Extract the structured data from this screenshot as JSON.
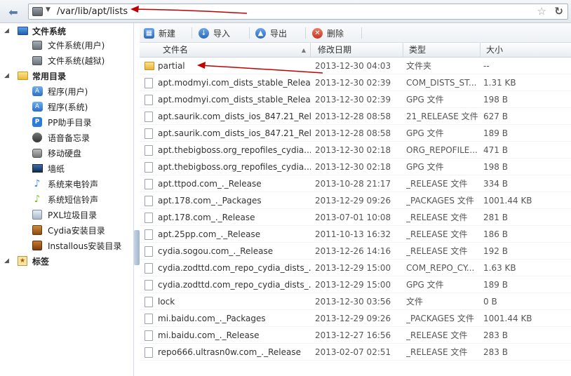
{
  "address": {
    "path": "/var/lib/apt/lists"
  },
  "sidebar": {
    "groups": [
      {
        "label": "文件系统",
        "items": [
          "文件系统(用户)",
          "文件系统(越狱)"
        ]
      },
      {
        "label": "常用目录",
        "items": [
          "程序(用户)",
          "程序(系统)",
          "PP助手目录",
          "语音备忘录",
          "移动硬盘",
          "墙纸",
          "系统来电铃声",
          "系统短信铃声",
          "PXL垃圾目录",
          "Cydia安装目录",
          "Installous安装目录"
        ]
      },
      {
        "label": "标签",
        "items": []
      }
    ]
  },
  "toolbar": {
    "new_label": "新建",
    "import_label": "导入",
    "export_label": "导出",
    "delete_label": "删除"
  },
  "table": {
    "columns": [
      "文件名",
      "修改日期",
      "类型",
      "大小"
    ],
    "rows": [
      {
        "name": "partial",
        "date": "2013-12-30 04:03",
        "type": "文件夹",
        "size": "--",
        "folder": true
      },
      {
        "name": "apt.modmyi.com_dists_stable_Relea...",
        "date": "2013-12-30 02:39",
        "type": "COM_DISTS_ST...",
        "size": "1.31 KB"
      },
      {
        "name": "apt.modmyi.com_dists_stable_Relea...",
        "date": "2013-12-30 02:39",
        "type": "GPG 文件",
        "size": "198 B"
      },
      {
        "name": "apt.saurik.com_dists_ios_847.21_Rel...",
        "date": "2013-12-28 08:58",
        "type": "21_RELEASE 文件",
        "size": "627 B"
      },
      {
        "name": "apt.saurik.com_dists_ios_847.21_Rel...",
        "date": "2013-12-28 08:58",
        "type": "GPG 文件",
        "size": "189 B"
      },
      {
        "name": "apt.thebigboss.org_repofiles_cydia...",
        "date": "2013-12-30 02:18",
        "type": "ORG_REPOFILE...",
        "size": "471 B"
      },
      {
        "name": "apt.thebigboss.org_repofiles_cydia...",
        "date": "2013-12-30 02:18",
        "type": "GPG 文件",
        "size": "198 B"
      },
      {
        "name": "apt.ttpod.com_._Release",
        "date": "2013-10-28 21:17",
        "type": "_RELEASE 文件",
        "size": "334 B"
      },
      {
        "name": "apt.178.com_._Packages",
        "date": "2013-12-29 09:26",
        "type": "_PACKAGES 文件",
        "size": "1001.44 KB"
      },
      {
        "name": "apt.178.com_._Release",
        "date": "2013-07-01 10:08",
        "type": "_RELEASE 文件",
        "size": "281 B"
      },
      {
        "name": "apt.25pp.com_._Release",
        "date": "2011-10-13 16:32",
        "type": "_RELEASE 文件",
        "size": "186 B"
      },
      {
        "name": "cydia.sogou.com_._Release",
        "date": "2013-12-26 14:16",
        "type": "_RELEASE 文件",
        "size": "192 B"
      },
      {
        "name": "cydia.zodttd.com_repo_cydia_dists_...",
        "date": "2013-12-29 15:00",
        "type": "COM_REPO_CY...",
        "size": "1.63 KB"
      },
      {
        "name": "cydia.zodttd.com_repo_cydia_dists_...",
        "date": "2013-12-29 15:00",
        "type": "GPG 文件",
        "size": "189 B"
      },
      {
        "name": "lock",
        "date": "2013-12-30 03:56",
        "type": "文件",
        "size": "0 B"
      },
      {
        "name": "mi.baidu.com_._Packages",
        "date": "2013-12-29 09:26",
        "type": "_PACKAGES 文件",
        "size": "1001.44 KB"
      },
      {
        "name": "mi.baidu.com_._Release",
        "date": "2013-12-27 16:56",
        "type": "_RELEASE 文件",
        "size": "283 B"
      },
      {
        "name": "repo666.ultrasn0w.com_._Release",
        "date": "2013-02-07 02:51",
        "type": "_RELEASE 文件",
        "size": "283 B"
      }
    ]
  },
  "colors": {
    "accent": "#5b7aa6",
    "annotation": "#c00000"
  }
}
